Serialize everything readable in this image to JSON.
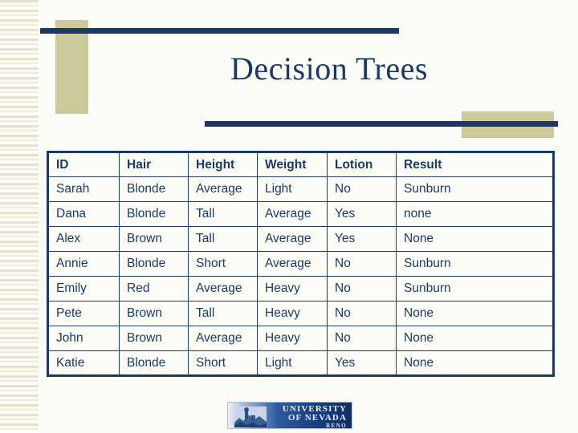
{
  "slide": {
    "title": "Decision Trees",
    "background_color": "#fdfdf7",
    "accent_navy": "#1b3a63",
    "accent_tan": "#ccc99a"
  },
  "table": {
    "headers": [
      "ID",
      "Hair",
      "Height",
      "Weight",
      "Lotion",
      "Result"
    ],
    "rows": [
      [
        "Sarah",
        "Blonde",
        "Average",
        "Light",
        "No",
        "Sunburn"
      ],
      [
        "Dana",
        "Blonde",
        "Tall",
        "Average",
        "Yes",
        "none"
      ],
      [
        "Alex",
        "Brown",
        "Tall",
        "Average",
        "Yes",
        "None"
      ],
      [
        "Annie",
        "Blonde",
        "Short",
        "Average",
        "No",
        "Sunburn"
      ],
      [
        "Emily",
        "Red",
        "Average",
        "Heavy",
        "No",
        "Sunburn"
      ],
      [
        "Pete",
        "Brown",
        "Tall",
        "Heavy",
        "No",
        "None"
      ],
      [
        "John",
        "Brown",
        "Average",
        "Heavy",
        "No",
        "None"
      ],
      [
        "Katie",
        "Blonde",
        "Short",
        "Light",
        "Yes",
        "None"
      ]
    ]
  },
  "logo": {
    "line1": "UNIVERSITY",
    "line2": "OF NEVADA",
    "line3": "RENO"
  }
}
